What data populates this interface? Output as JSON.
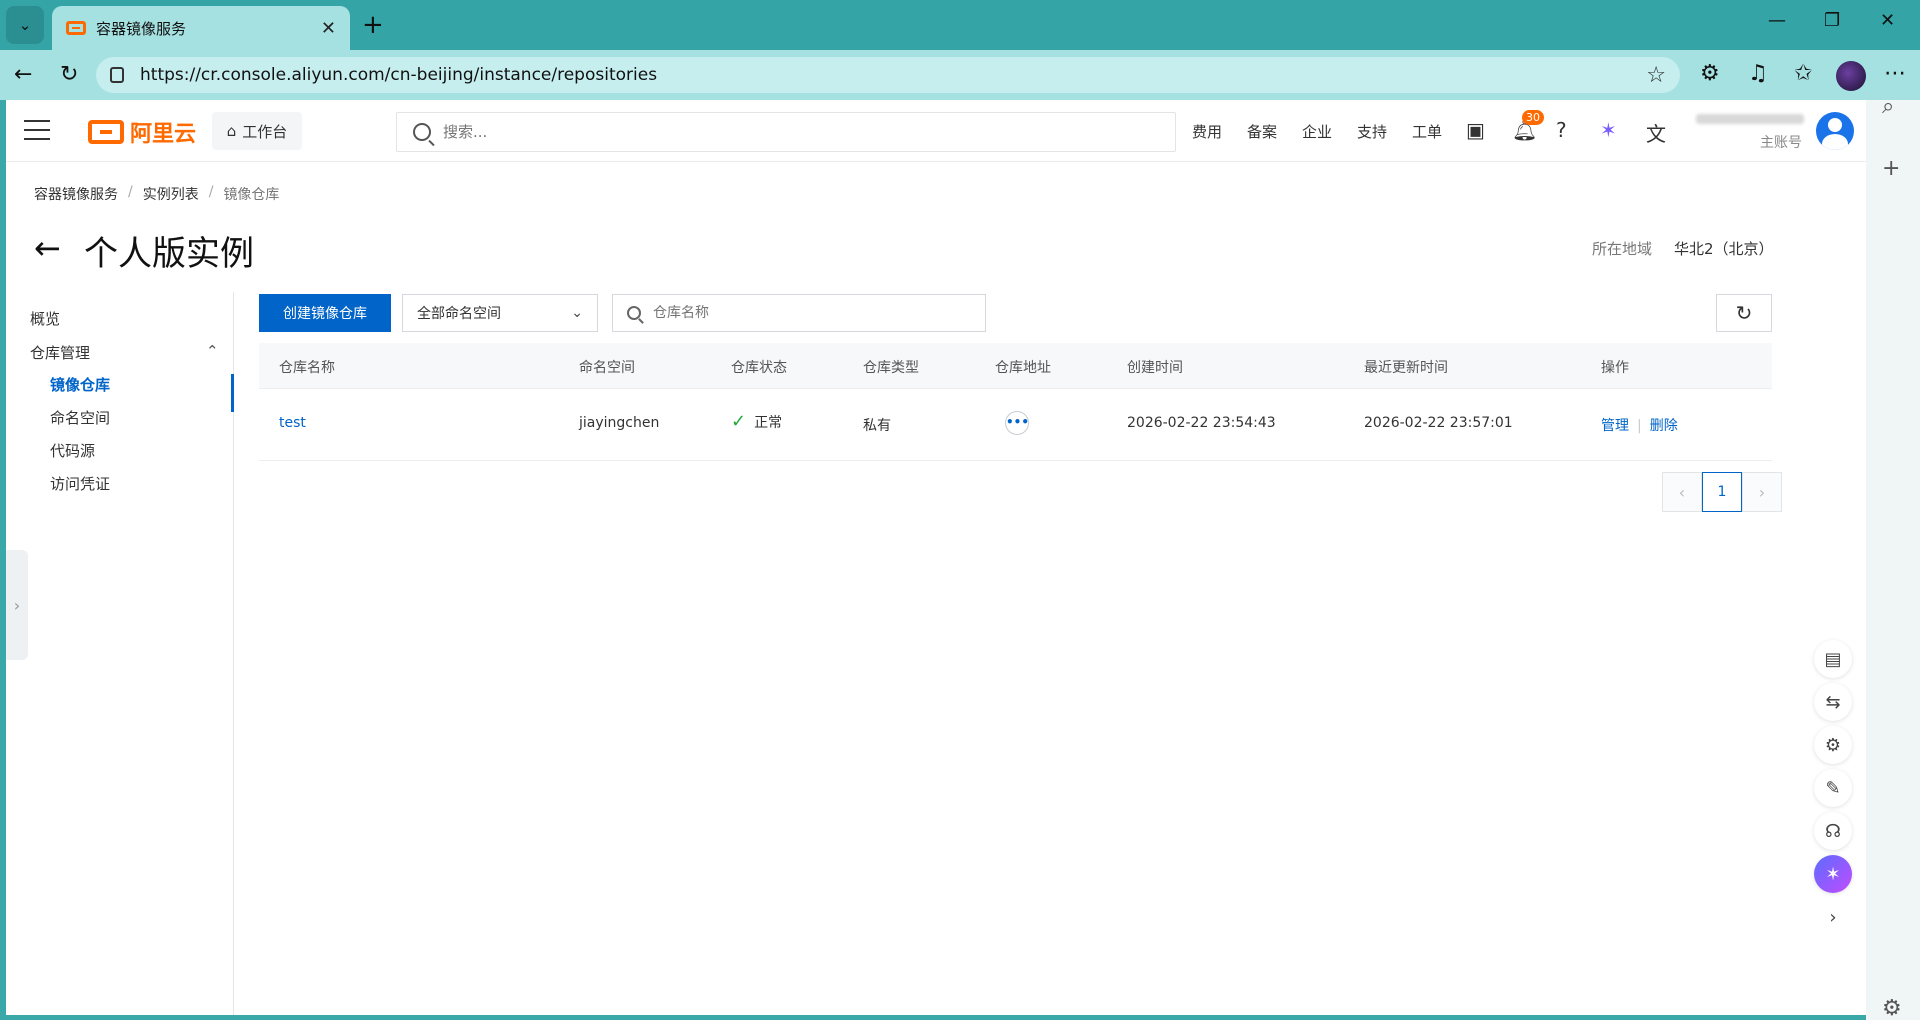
{
  "browser": {
    "tab_title": "容器镜像服务",
    "tab_close": "✕",
    "new_tab": "+",
    "url": "https://cr.console.aliyun.com/cn-beijing/instance/repositories"
  },
  "topnav": {
    "logo_text": "阿里云",
    "workbench": "工作台",
    "search_placeholder": "搜索...",
    "menu": [
      "费用",
      "备案",
      "企业",
      "支持",
      "工单"
    ],
    "notification_count": "30",
    "account_role": "主账号"
  },
  "breadcrumb": [
    "容器镜像服务",
    "实例列表",
    "镜像仓库"
  ],
  "header": {
    "title": "个人版实例",
    "region_label": "所在地域",
    "region_value": "华北2（北京）"
  },
  "sidenav": {
    "overview": "概览",
    "repo_mgmt": "仓库管理",
    "items": [
      "镜像仓库",
      "命名空间",
      "代码源",
      "访问凭证"
    ]
  },
  "toolbar": {
    "create_button": "创建镜像仓库",
    "namespace_select": "全部命名空间",
    "search_placeholder": "仓库名称"
  },
  "table": {
    "headers": [
      "仓库名称",
      "命名空间",
      "仓库状态",
      "仓库类型",
      "仓库地址",
      "创建时间",
      "最近更新时间",
      "操作"
    ],
    "rows": [
      {
        "name": "test",
        "namespace": "jiayingchen",
        "status": "正常",
        "type": "私有",
        "created": "2026-02-22 23:54:43",
        "updated": "2026-02-22 23:57:01",
        "op_manage": "管理",
        "op_delete": "删除"
      }
    ]
  },
  "pagination": {
    "current": "1"
  },
  "colors": {
    "primary": "#0064c8",
    "brand": "#ff6a00",
    "success": "#22a83a"
  }
}
